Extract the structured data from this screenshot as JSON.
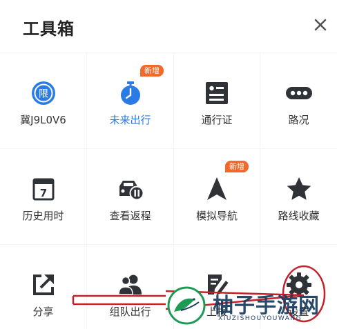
{
  "header": {
    "title": "工具箱"
  },
  "colors": {
    "icon_blue": "#2b7be6",
    "icon_dark": "#2f3338",
    "badge": "#f26a2a",
    "annotation_red": "#c3202a"
  },
  "tiles": [
    {
      "label": "冀J9L0V6",
      "icon": "restricted-plate-icon"
    },
    {
      "label": "未来出行",
      "icon": "stopwatch-icon",
      "badge": "新增"
    },
    {
      "label": "通行证",
      "icon": "pass-card-icon"
    },
    {
      "label": "路况",
      "icon": "traffic-dots-icon"
    },
    {
      "label": "历史用时",
      "icon": "calendar-7-icon"
    },
    {
      "label": "查看返程",
      "icon": "return-car-icon"
    },
    {
      "label": "模拟导航",
      "icon": "navigation-arrow-icon",
      "badge": "新增"
    },
    {
      "label": "路线收藏",
      "icon": "star-icon"
    },
    {
      "label": "分享",
      "icon": "share-icon"
    },
    {
      "label": "组队出行",
      "icon": "group-icon"
    },
    {
      "label": "上报",
      "icon": "report-edit-icon"
    },
    {
      "label": "设置",
      "icon": "gear-icon"
    }
  ],
  "limit_icon_text": "限",
  "calendar_icon_text": "7",
  "watermark": {
    "text": "柚子手游网",
    "sub": "XIUZISHOUYOUWANG"
  }
}
